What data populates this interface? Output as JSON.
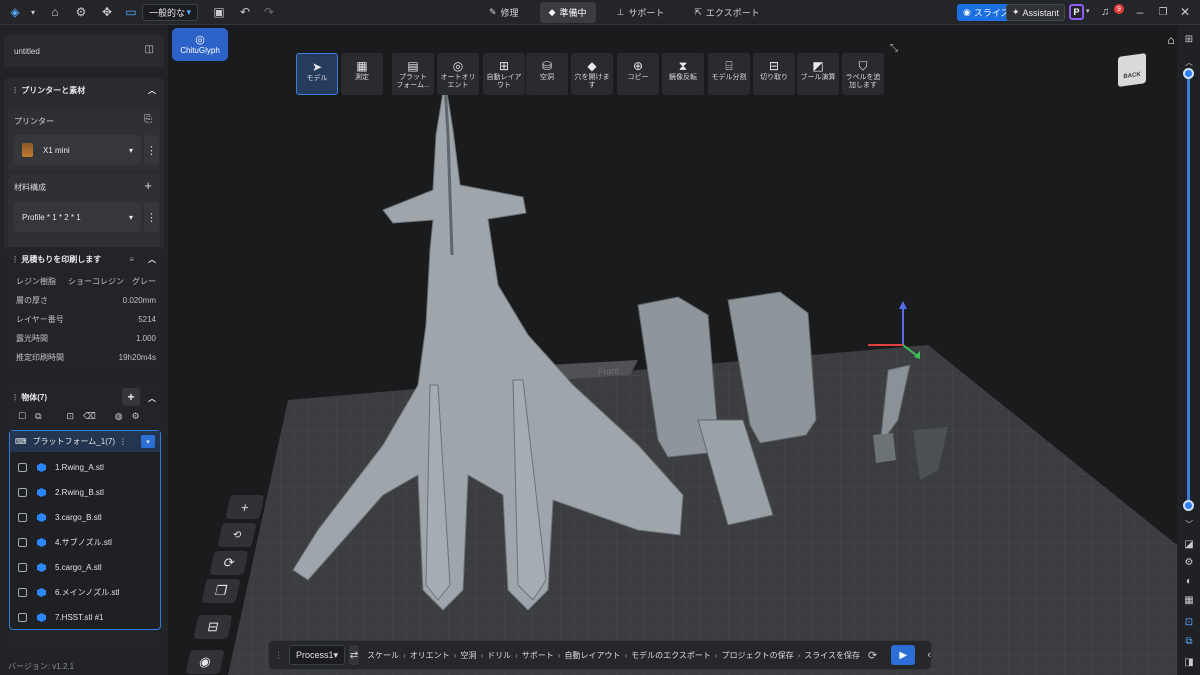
{
  "topbar": {
    "preset": "一般的な",
    "tabs": [
      {
        "icon": "wrench-icon",
        "label": "修理"
      },
      {
        "icon": "cube-icon",
        "label": "準備中"
      },
      {
        "icon": "support-icon",
        "label": "サポート"
      },
      {
        "icon": "export-icon",
        "label": "エクスポート"
      }
    ],
    "slice_label": "スライス",
    "assistant_label": "Assistant",
    "notif_count": "9"
  },
  "sidebar": {
    "project_name": "untitled",
    "printer_section": "プリンターと素材",
    "printer_label": "プリンター",
    "printer_value": "X1 mini",
    "material_label": "材料構成",
    "material_value": "Profile * 1 * 2 * 1",
    "estimate_title": "見積もりを印刷します",
    "estimate_rows": [
      {
        "k": "レジン樹脂",
        "v": "ショーコレジン　グレー"
      },
      {
        "k": "層の厚さ",
        "v": "0.020mm"
      },
      {
        "k": "レイヤー番号",
        "v": "5214"
      },
      {
        "k": "露光時間",
        "v": "1.000"
      },
      {
        "k": "推定印刷時間",
        "v": "19h20m4s"
      }
    ],
    "objects_title": "物体(7)",
    "platform_label": "プラットフォーム_1(7)",
    "objects": [
      "1.Rwing_A.stl",
      "2.Rwing_B.stl",
      "3.cargo_B.stl",
      "4.サブノズル.stl",
      "5.cargo_A.stl",
      "6.メインノズル.stl",
      "7.HSST.stl #1"
    ],
    "version": "バージョン: v1.2.1"
  },
  "logo": "ChituGlyph",
  "tools": [
    {
      "icon": "cursor-icon",
      "label": "モデル"
    },
    {
      "icon": "ruler-icon",
      "label": "測定"
    },
    {
      "icon": "platform-icon",
      "label": "プラット\nフォーム..."
    },
    {
      "icon": "orient-icon",
      "label": "オートオリ\nエント"
    },
    {
      "icon": "layout-icon",
      "label": "自動レイア\nウト"
    },
    {
      "icon": "hollow-icon",
      "label": "空洞"
    },
    {
      "icon": "hole-icon",
      "label": "穴を開けま\nす"
    },
    {
      "icon": "copy-icon",
      "label": "コピー"
    },
    {
      "icon": "mirror-icon",
      "label": "鏡像反転"
    },
    {
      "icon": "split-icon",
      "label": "モデル分割"
    },
    {
      "icon": "cut-icon",
      "label": "切り取り"
    },
    {
      "icon": "boolean-icon",
      "label": "ブール演算"
    },
    {
      "icon": "label-icon",
      "label": "ラベルを追\n加します"
    }
  ],
  "viewcube": "BACK",
  "plate_text": "Front",
  "workflow": {
    "process": "Process1",
    "steps": [
      "スケール",
      "オリエント",
      "空洞",
      "ドリル",
      "サポート",
      "自動レイアウト",
      "モデルのエクスポート",
      "プロジェクトの保存",
      "スライスを保存"
    ]
  }
}
